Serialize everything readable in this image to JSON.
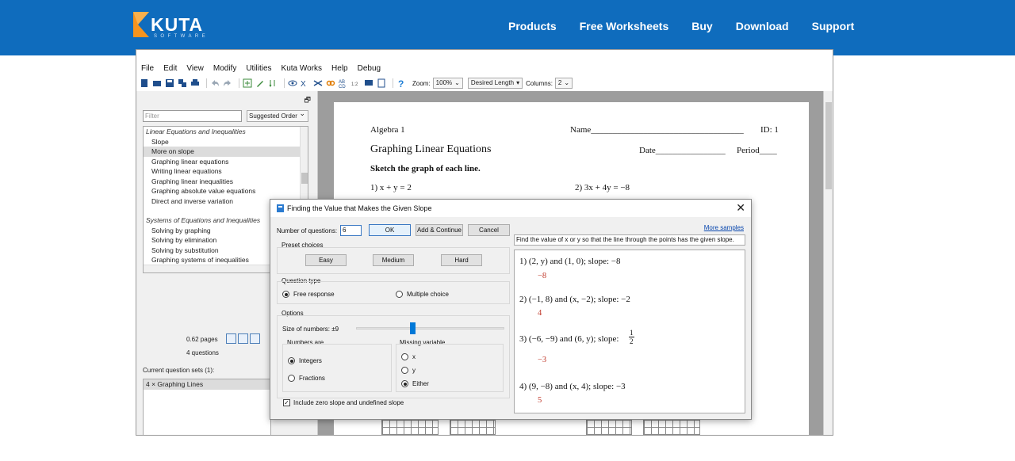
{
  "site": {
    "logo_text": "KUTA",
    "logo_sub": "SOFTWARE",
    "brand_color": "#0f6cbd",
    "nav": [
      "Products",
      "Free Worksheets",
      "Buy",
      "Download",
      "Support"
    ]
  },
  "app": {
    "menu": [
      "File",
      "Edit",
      "View",
      "Modify",
      "Utilities",
      "Kuta Works",
      "Help",
      "Debug"
    ],
    "toolbar": {
      "zoom_label": "Zoom:",
      "zoom_value": "100%",
      "length_value": "Desired Length",
      "columns_label": "Columns:",
      "columns_value": "2"
    },
    "left_panel": {
      "filter_placeholder": "Filter",
      "order_value": "Suggested Order",
      "categories": [
        {
          "name": "Linear Equations and Inequalities",
          "items": [
            "Slope",
            "More on slope",
            "Graphing linear equations",
            "Writing linear equations",
            "Graphing linear inequalities",
            "Graphing absolute value equations",
            "Direct and inverse variation"
          ]
        },
        {
          "name": "Systems of Equations and Inequalities",
          "items": [
            "Solving by graphing",
            "Solving by elimination",
            "Solving by substitution",
            "Graphing systems of inequalities"
          ]
        }
      ],
      "selected_item": "More on slope",
      "pages": "0.62 pages",
      "questions": "4 questions",
      "current_sets_label": "Current question sets (1):",
      "current_set": "4 × Graphing Lines"
    },
    "document": {
      "course": "Algebra 1",
      "name_label": "Name___________________________________",
      "id_label": "ID: 1",
      "title": "Graphing Linear Equations",
      "date_label": "Date________________",
      "period_label": "Period____",
      "instructions": "Sketch the graph of each line.",
      "q1": "1)  x + y = 2",
      "q2": "2)  3x + 4y = −8"
    }
  },
  "dialog": {
    "title": "Finding the Value that Makes the Given Slope",
    "num_questions_label": "Number of questions:",
    "num_questions_value": "6",
    "ok": "OK",
    "add_continue": "Add & Continue",
    "cancel": "Cancel",
    "preset_label": "Preset choices",
    "preset": [
      "Easy",
      "Medium",
      "Hard"
    ],
    "question_type_label": "Question type",
    "free_response": "Free response",
    "multiple_choice": "Multiple choice",
    "options_label": "Options",
    "size_label": "Size of numbers: ±9",
    "size_value": 9,
    "size_fraction": 0.45,
    "numbers_are_label": "Numbers are",
    "integers": "Integers",
    "fractions": "Fractions",
    "missing_var_label": "Missing variable",
    "var_x": "x",
    "var_y": "y",
    "var_either": "Either",
    "include_zero": "Include zero slope and undefined slope",
    "more_samples": "More samples",
    "description": "Find the value of x or y so that the line through the points has the given slope.",
    "preview": [
      {
        "q": "1)  (2, y) and (1, 0); slope: −8",
        "a": "−8"
      },
      {
        "q": "2)  (−1, 8) and (x, −2); slope: −2",
        "a": "4"
      },
      {
        "q": "3)  (−6, −9) and (6, y); slope:",
        "num": "1",
        "den": "2",
        "a": "−3"
      },
      {
        "q": "4)  (9, −8) and (x, 4); slope: −3",
        "a": "5"
      }
    ],
    "answer_color": "#c0392b"
  }
}
